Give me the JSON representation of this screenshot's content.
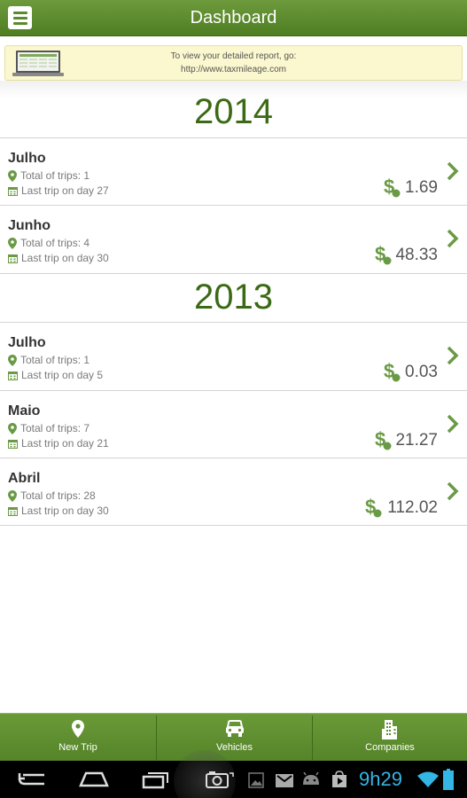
{
  "header": {
    "title": "Dashboard"
  },
  "banner": {
    "line1": "To view your detailed report, go:",
    "line2": "http://www.taxmileage.com"
  },
  "sections": [
    {
      "year": "2014",
      "items": [
        {
          "month": "Julho",
          "trips": "Total of trips: 1",
          "last_trip": "Last trip on day 27",
          "amount": "1.69"
        },
        {
          "month": "Junho",
          "trips": "Total of trips: 4",
          "last_trip": "Last trip on day 30",
          "amount": "48.33"
        }
      ]
    },
    {
      "year": "2013",
      "items": [
        {
          "month": "Julho",
          "trips": "Total of trips: 1",
          "last_trip": "Last trip on day 5",
          "amount": "0.03"
        },
        {
          "month": "Maio",
          "trips": "Total of trips: 7",
          "last_trip": "Last trip on day 21",
          "amount": "21.27"
        },
        {
          "month": "Abril",
          "trips": "Total of trips: 28",
          "last_trip": "Last trip on day 30",
          "amount": "112.02"
        }
      ]
    }
  ],
  "bottom_nav": [
    {
      "label": "New Trip",
      "icon": "map-pin-icon"
    },
    {
      "label": "Vehicles",
      "icon": "car-icon"
    },
    {
      "label": "Companies",
      "icon": "building-icon"
    }
  ],
  "system_bar": {
    "time": "9h29"
  },
  "colors": {
    "brand_green": "#5a8a2c",
    "year_green": "#3b6a16",
    "clock_blue": "#33b5e5"
  }
}
